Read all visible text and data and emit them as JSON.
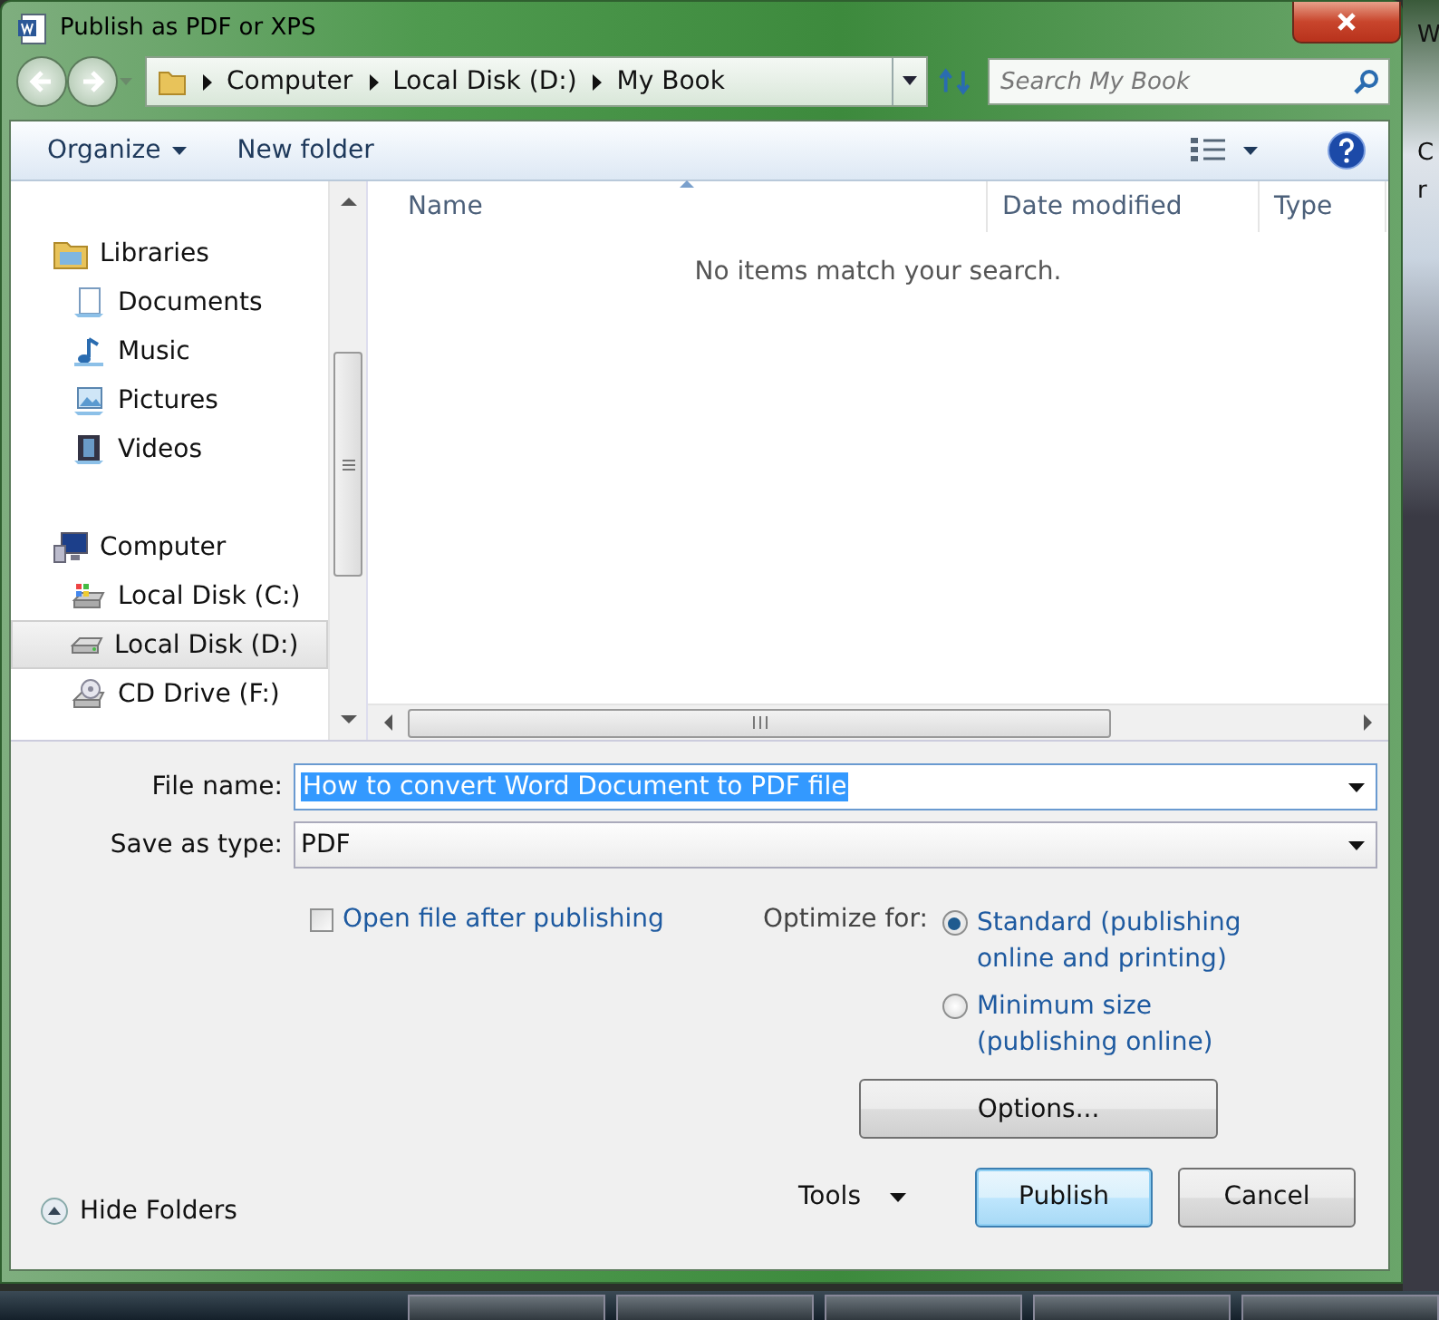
{
  "window": {
    "title": "Publish as PDF or XPS"
  },
  "address_bar": {
    "crumbs": [
      "Computer",
      "Local Disk (D:)",
      "My Book"
    ]
  },
  "search": {
    "placeholder": "Search My Book"
  },
  "toolbar": {
    "items": [
      {
        "label": "Organize",
        "kind": "menu"
      },
      {
        "label": "New folder",
        "kind": "button"
      }
    ]
  },
  "navigation": {
    "groups": [
      {
        "label": "Libraries",
        "kind": "libraries",
        "selected": false,
        "children": [
          {
            "label": "Documents",
            "kind": "documents",
            "selected": false
          },
          {
            "label": "Music",
            "kind": "music",
            "selected": false
          },
          {
            "label": "Pictures",
            "kind": "pictures",
            "selected": false
          },
          {
            "label": "Videos",
            "kind": "videos",
            "selected": false
          }
        ]
      },
      {
        "label": "Computer",
        "kind": "computer",
        "selected": false,
        "children": [
          {
            "label": "Local Disk (C:)",
            "kind": "system-disk",
            "selected": false
          },
          {
            "label": "Local Disk (D:)",
            "kind": "disk",
            "selected": true
          },
          {
            "label": "CD Drive (F:)",
            "kind": "cd",
            "selected": false
          }
        ]
      }
    ]
  },
  "file_list": {
    "columns": [
      {
        "label": "Name",
        "sorted": true
      },
      {
        "label": "Date modified",
        "sorted": false
      },
      {
        "label": "Type",
        "sorted": false
      }
    ],
    "empty_message": "No items match your search."
  },
  "form": {
    "file_name": {
      "label": "File name:",
      "value": "How to convert Word Document to PDF file",
      "selected": true
    },
    "save_as_type": {
      "label": "Save as type:",
      "value": "PDF"
    },
    "open_after": {
      "label": "Open file after publishing",
      "checked": false
    },
    "optimize": {
      "label": "Optimize for:",
      "options": [
        {
          "label": "Standard (publishing online and printing)",
          "selected": true
        },
        {
          "label": "Minimum size (publishing online)",
          "selected": false
        }
      ]
    },
    "options_button": "Options..."
  },
  "footer": {
    "hide_folders": "Hide Folders",
    "tools": "Tools",
    "buttons": [
      {
        "label": "Publish",
        "kind": "default"
      },
      {
        "label": "Cancel",
        "kind": "normal"
      }
    ]
  },
  "background": {
    "fragments": [
      "W",
      "C",
      "r"
    ]
  }
}
